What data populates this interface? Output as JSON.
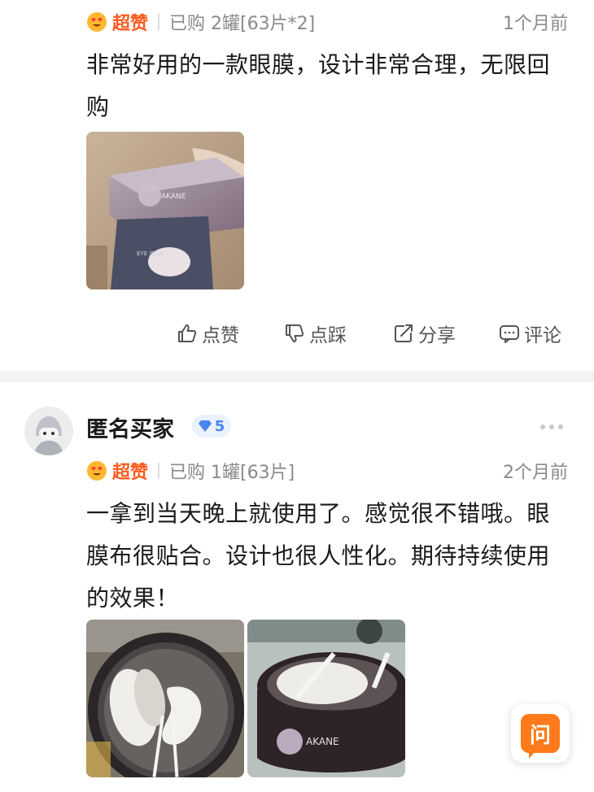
{
  "reviews": [
    {
      "rating_label": "超赞",
      "purchase_info": "已购 2罐[63片*2]",
      "time_ago": "1个月前",
      "text_line1": "非常好用的一款眼膜，设计非常合理，无限回",
      "text_line2": "购",
      "photo_brand_text": "AKANE",
      "photo_pouch_text": "EYE JELLY"
    },
    {
      "username": "匿名买家",
      "level": "5",
      "rating_label": "超赞",
      "purchase_info": "已购 1罐[63片]",
      "time_ago": "2个月前",
      "text_line1": "一拿到当天晚上就使用了。感觉很不错哦。眼",
      "text_line2": "膜布很贴合。设计也很人性化。期待持续使用",
      "text_line3": "的效果！",
      "photo_brand_text": "AKANE"
    }
  ],
  "actions": {
    "like": "点赞",
    "dislike": "点踩",
    "share": "分享",
    "comment": "评论"
  },
  "ask_button_label": "问",
  "colors": {
    "accent_orange": "#ff5a1f",
    "muted_gray": "#8a8a8a",
    "level_blue": "#4a86f0"
  }
}
